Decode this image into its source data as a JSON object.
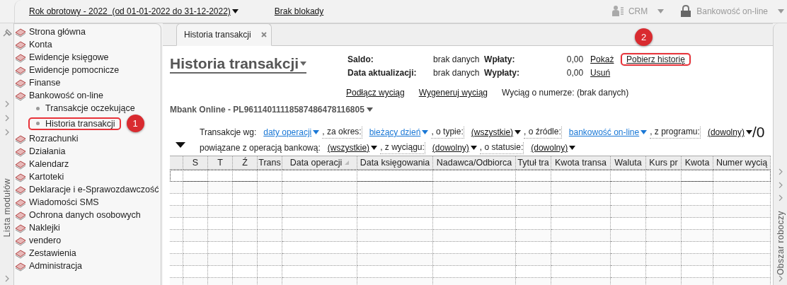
{
  "top_bar": {
    "fiscal_year": "Rok obrotowy - 2022  (od 01-01-2022 do 31-12-2022)",
    "lock_status": "Brak blokady",
    "modules": [
      {
        "label": "CRM",
        "kind": "person"
      },
      {
        "label": "Bankowość on-line",
        "kind": "lock"
      }
    ]
  },
  "left_strip": {
    "label": "Lista modułów"
  },
  "sidebar": {
    "items": [
      {
        "label": "Strona główna"
      },
      {
        "label": "Konta"
      },
      {
        "label": "Ewidencje księgowe"
      },
      {
        "label": "Ewidencje pomocnicze"
      },
      {
        "label": "Finanse"
      },
      {
        "label": "Bankowość on-line",
        "children": [
          {
            "label": "Transakcje oczekujące"
          },
          {
            "label": "Historia transakcji",
            "annotation": "1"
          }
        ]
      },
      {
        "label": "Rozrachunki"
      },
      {
        "label": "Działania"
      },
      {
        "label": "Kalendarz"
      },
      {
        "label": "Kartoteki"
      },
      {
        "label": "Deklaracje i e-Sprawozdawczość"
      },
      {
        "label": "Wiadomości SMS"
      },
      {
        "label": "Ochrona danych osobowych"
      },
      {
        "label": "Naklejki"
      },
      {
        "label": "vendero"
      },
      {
        "label": "Zestawienia"
      },
      {
        "label": "Administracja"
      }
    ]
  },
  "tabs": [
    {
      "label": "Historia transakcji",
      "selected": true
    }
  ],
  "panel": {
    "title": "Historia transakcji",
    "summary_rows": [
      {
        "label": "Saldo:",
        "value": "brak danych",
        "flow_label": "Wpłaty:",
        "flow_amount": "0,00",
        "link": "Pokaż"
      },
      {
        "label": "Data aktualizacji:",
        "value": "brak danych",
        "flow_label": "Wypłaty:",
        "flow_amount": "0,00",
        "link": "Usuń"
      }
    ],
    "download_link": {
      "label": "Pobierz historię",
      "annotation": "2"
    },
    "statement_links": [
      "Podłącz wyciąg",
      "Wygeneruj wyciąg"
    ],
    "statement_number": "Wyciąg o numerze: (brak danych)",
    "account": "Mbank Online - PL96114011118587486478116805",
    "filter_rows": [
      {
        "filters": [
          {
            "label": "Transakcje wg:",
            "value": "daty operacji",
            "kind": "link"
          },
          {
            "label": ", za okres:",
            "value": "bieżący dzień",
            "kind": "link"
          },
          {
            "label": ", o typie:",
            "value": "(wszystkie)",
            "kind": "plain"
          },
          {
            "label": ", o źródle:",
            "value": "bankowość on-line",
            "kind": "link"
          },
          {
            "label": ", z programu:",
            "value": "(dowolny)",
            "kind": "plain"
          }
        ]
      },
      {
        "filters": [
          {
            "label": "powiązane z operacją bankową:",
            "value": "(wszystkie)",
            "kind": "plain"
          },
          {
            "label": ", z wyciągu:",
            "value": "(dowolny)",
            "kind": "plain"
          },
          {
            "label": ", o statusie:",
            "value": "(dowolny)",
            "kind": "plain"
          }
        ]
      }
    ],
    "count": "/0"
  },
  "table": {
    "columns": [
      {
        "label": "S",
        "sorted": false
      },
      {
        "label": "T",
        "sorted": false
      },
      {
        "label": "Ź",
        "sorted": false
      },
      {
        "label": "Trans",
        "sorted": false
      },
      {
        "label": "Data operacji",
        "sorted": true
      },
      {
        "label": "Data księgowania",
        "sorted": false
      },
      {
        "label": "Nadawca/Odbiorca",
        "sorted": false
      },
      {
        "label": "Tytuł tra",
        "sorted": false
      },
      {
        "label": "Kwota transa",
        "sorted": false
      },
      {
        "label": "Waluta",
        "sorted": false
      },
      {
        "label": "Kurs pr",
        "sorted": false
      },
      {
        "label": "Kwota",
        "sorted": false
      },
      {
        "label": "Numer wycią",
        "sorted": false
      }
    ]
  },
  "right_strip": {
    "label": "Obszar roboczy"
  }
}
